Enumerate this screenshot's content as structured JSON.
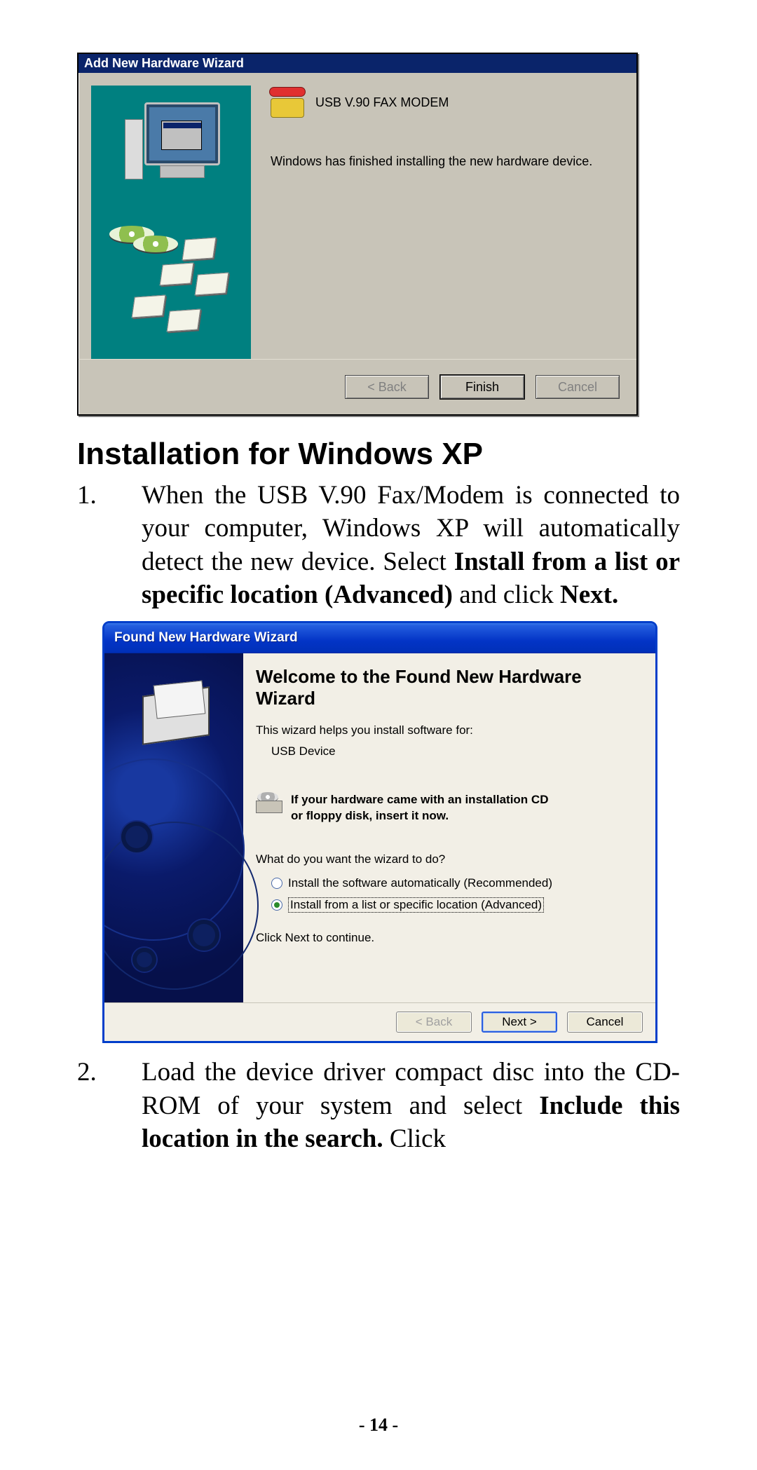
{
  "win98": {
    "title": "Add New Hardware Wizard",
    "device_name": "USB V.90 FAX MODEM",
    "message": "Windows has finished installing the new hardware device.",
    "buttons": {
      "back": "< Back",
      "finish": "Finish",
      "cancel": "Cancel"
    }
  },
  "heading": "Installation for Windows XP",
  "step1": {
    "num": "1.",
    "pre": "When the USB V.90 Fax/Modem is connected to your computer, Windows XP will automatically detect the new device. Select ",
    "bold1": "Install from a list or specific location (Advanced) ",
    "mid": "and click ",
    "bold2": "Next."
  },
  "xp": {
    "title": "Found New Hardware Wizard",
    "heading": "Welcome to the Found New Hardware Wizard",
    "sub": "This wizard helps you install software for:",
    "device": "USB Device",
    "cd_line1": "If your hardware came with an installation CD",
    "cd_line2": "or floppy disk, insert it now.",
    "question": "What do you want the wizard to do?",
    "opt_auto": "Install the software automatically (Recommended)",
    "opt_adv": "Install from a list or specific location (Advanced)",
    "continue": "Click Next to continue.",
    "buttons": {
      "back": "< Back",
      "next": "Next >",
      "cancel": "Cancel"
    }
  },
  "step2": {
    "num": "2.",
    "pre": "Load the device driver compact disc into the CD-ROM of your system and select ",
    "bold": "Include this location in the search. ",
    "post": "Click"
  },
  "page_number": "- 14 -"
}
